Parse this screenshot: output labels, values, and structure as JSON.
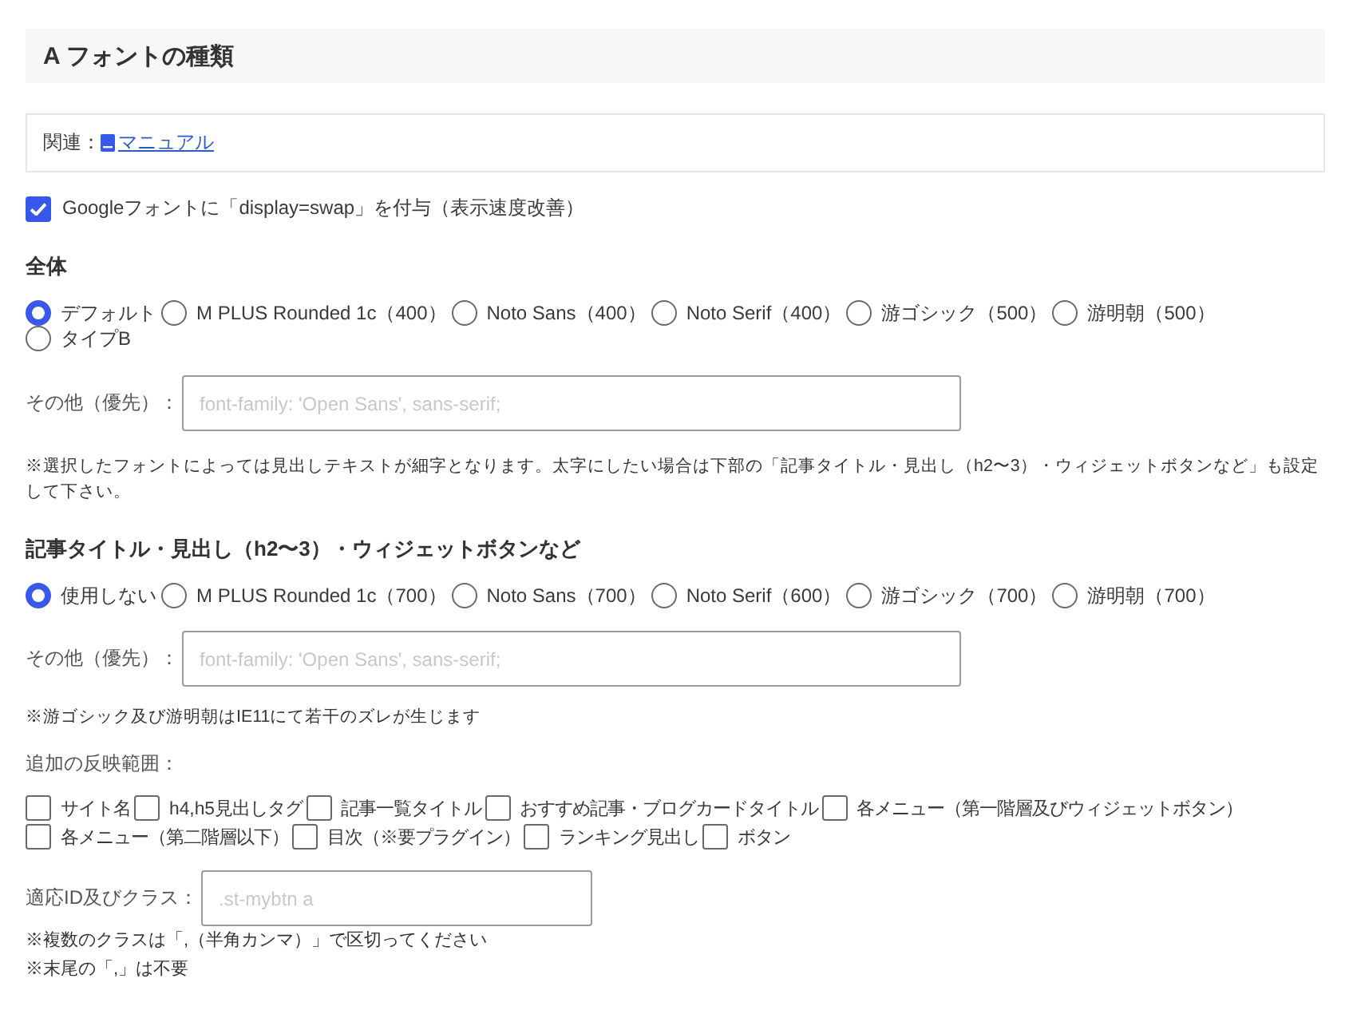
{
  "header": {
    "title": "A フォントの種類"
  },
  "related": {
    "label": "関連：",
    "link": "マニュアル"
  },
  "google_swap": {
    "label": "Googleフォントに「display=swap」を付与（表示速度改善）",
    "checked": true
  },
  "sections": [
    {
      "title": "全体",
      "options": [
        {
          "label": "デフォルト",
          "selected": true
        },
        {
          "label": "M PLUS Rounded 1c（400）",
          "selected": false
        },
        {
          "label": "Noto Sans（400）",
          "selected": false
        },
        {
          "label": "Noto Serif（400）",
          "selected": false
        },
        {
          "label": "游ゴシック（500）",
          "selected": false
        },
        {
          "label": "游明朝（500）",
          "selected": false
        },
        {
          "label": "タイプB",
          "selected": false
        }
      ],
      "other": {
        "label": "その他（優先）：",
        "placeholder": "font-family: 'Open Sans', sans-serif;"
      },
      "note": "※選択したフォントによっては見出しテキストが細字となります。太字にしたい場合は下部の「記事タイトル・見出し（h2〜3）・ウィジェットボタンなど」も設定して下さい。"
    },
    {
      "title": "記事タイトル・見出し（h2〜3）・ウィジェットボタンなど",
      "options": [
        {
          "label": "使用しない",
          "selected": true
        },
        {
          "label": "M PLUS Rounded 1c（700）",
          "selected": false
        },
        {
          "label": "Noto Sans（700）",
          "selected": false
        },
        {
          "label": "Noto Serif（600）",
          "selected": false
        },
        {
          "label": "游ゴシック（700）",
          "selected": false
        },
        {
          "label": "游明朝（700）",
          "selected": false
        }
      ],
      "other": {
        "label": "その他（優先）：",
        "placeholder": "font-family: 'Open Sans', sans-serif;"
      },
      "note": "※游ゴシック及び游明朝はIE11にて若干のズレが生じます"
    }
  ],
  "scope": {
    "label": "追加の反映範囲：",
    "options": [
      {
        "label": "サイト名",
        "checked": false
      },
      {
        "label": "h4,h5見出しタグ",
        "checked": false
      },
      {
        "label": "記事一覧タイトル",
        "checked": false
      },
      {
        "label": "おすすめ記事・ブログカードタイトル",
        "checked": false
      },
      {
        "label": "各メニュー（第一階層及びウィジェットボタン）",
        "checked": false
      },
      {
        "label": "各メニュー（第二階層以下）",
        "checked": false
      },
      {
        "label": "目次（※要プラグイン）",
        "checked": false
      },
      {
        "label": "ランキング見出し",
        "checked": false
      },
      {
        "label": "ボタン",
        "checked": false
      }
    ]
  },
  "class_field": {
    "label": "適応ID及びクラス：",
    "placeholder": ".st-mybtn a"
  },
  "notes": [
    "※複数のクラスは「,（半角カンマ）」で区切ってください",
    "※末尾の「,」は不要"
  ]
}
